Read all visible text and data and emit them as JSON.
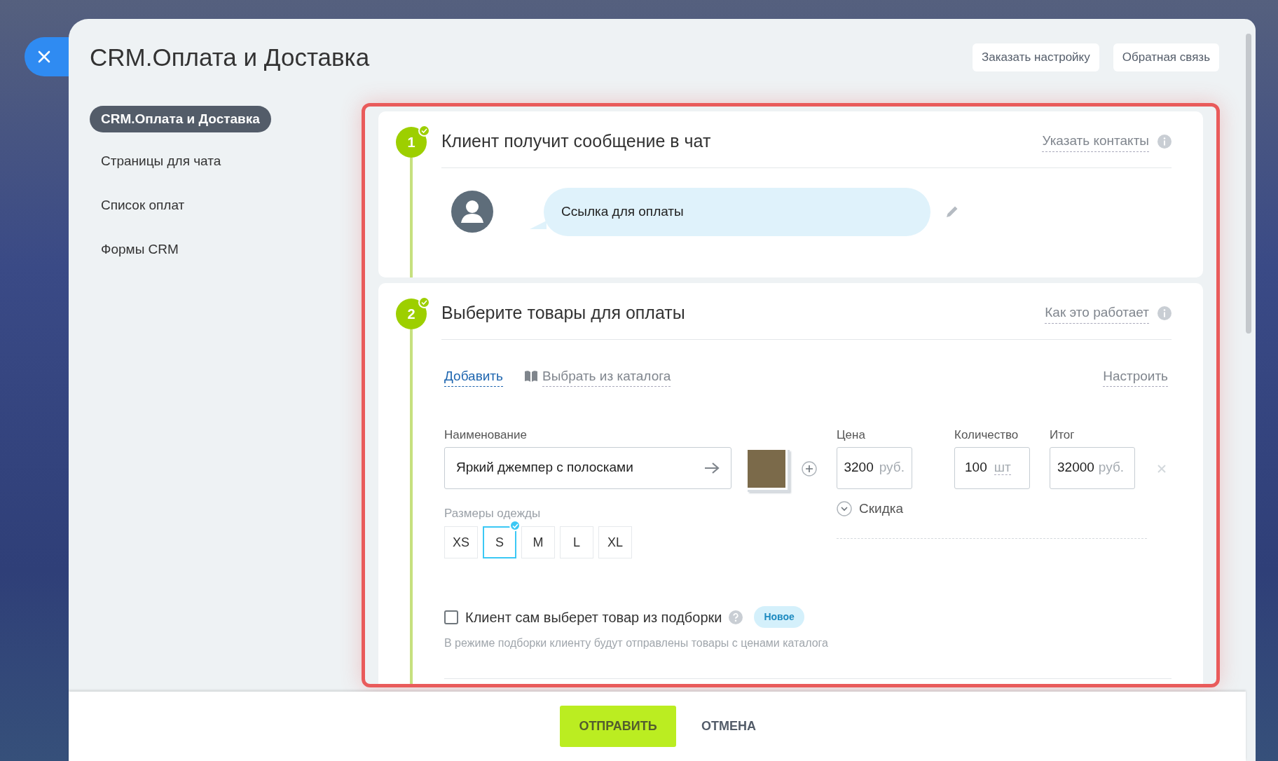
{
  "title": "CRM.Оплата и Доставка",
  "header_buttons": [
    "Заказать настройку",
    "Обратная связь"
  ],
  "menu": [
    {
      "label": "CRM.Оплата и Доставка",
      "selected": true
    },
    {
      "label": "Страницы для чата",
      "selected": false
    },
    {
      "label": "Список оплат",
      "selected": false
    },
    {
      "label": "Формы CRM",
      "selected": false
    }
  ],
  "step_1": {
    "number": "1",
    "completed": true,
    "title": "Клиент получит сообщение в чат",
    "link": "Указать контакты",
    "message": "Ссылка для оплаты"
  },
  "step_2": {
    "number": "2",
    "completed": true,
    "title": "Выберите товары для оплаты",
    "link": "Как это работает",
    "toolbar": {
      "add": "Добавить",
      "catalog": "Выбрать из каталога",
      "configure": "Настроить"
    },
    "product": {
      "name_label": "Наименование",
      "name": "Яркий джемпер с полосками",
      "price_label": "Цена",
      "price": "3200",
      "price_unit": "руб.",
      "quantity_label": "Количество",
      "quantity": "100",
      "quantity_unit": "шт",
      "total_label": "Итог",
      "total": "32000",
      "total_unit": "руб.",
      "discount": "Скидка"
    },
    "sizes": {
      "label": "Размеры одежды",
      "options": [
        {
          "label": "XS",
          "selected": false
        },
        {
          "label": "S",
          "selected": true
        },
        {
          "label": "M",
          "selected": false
        },
        {
          "label": "L",
          "selected": false
        },
        {
          "label": "XL",
          "selected": false
        }
      ]
    },
    "selection": {
      "checked": false,
      "label": "Клиент сам выберет товар из подборки",
      "badge": "Новое",
      "hint": "В режиме подборки клиенту будут отправлены товары с ценами каталога"
    }
  },
  "footer": {
    "submit": "ОТПРАВИТЬ",
    "cancel": "ОТМЕНА"
  }
}
